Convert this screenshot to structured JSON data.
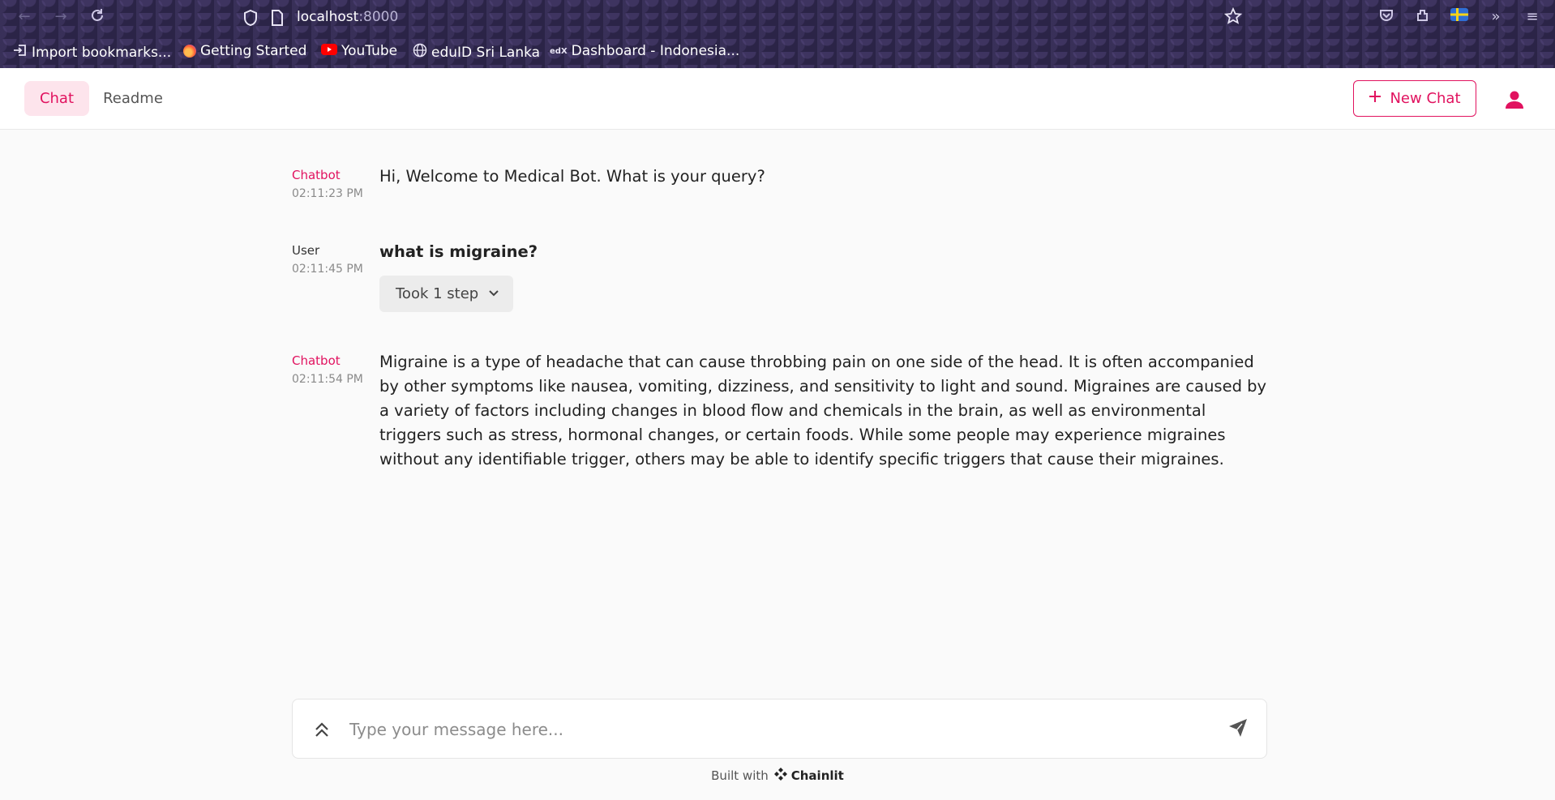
{
  "browser": {
    "url_host": "localhost",
    "url_port": ":8000",
    "bookmarks": [
      {
        "label": "Import bookmarks...",
        "icon": "import-icon"
      },
      {
        "label": "Getting Started",
        "icon": "firefox-icon"
      },
      {
        "label": "YouTube",
        "icon": "youtube-icon"
      },
      {
        "label": "eduID Sri Lanka",
        "icon": "globe-icon"
      },
      {
        "label": "Dashboard - Indonesia...",
        "icon": "edx-icon"
      }
    ]
  },
  "header": {
    "tabs": [
      {
        "label": "Chat"
      },
      {
        "label": "Readme"
      }
    ],
    "new_chat_label": "New Chat",
    "accent_color": "#e1125f"
  },
  "messages": [
    {
      "author": "Chatbot",
      "time": "02:11:23 PM",
      "text": "Hi, Welcome to Medical Bot. What is your query?"
    },
    {
      "author": "User",
      "time": "02:11:45 PM",
      "text": "what is migraine?",
      "step_label": "Took 1 step"
    },
    {
      "author": "Chatbot",
      "time": "02:11:54 PM",
      "text": "Migraine is a type of headache that can cause throbbing pain on one side of the head. It is often accompanied by other symptoms like nausea, vomiting, dizziness, and sensitivity to light and sound. Migraines are caused by a variety of factors including changes in blood flow and chemicals in the brain, as well as environmental triggers such as stress, hormonal changes, or certain foods. While some people may experience migraines without any identifiable trigger, others may be able to identify specific triggers that cause their migraines."
    }
  ],
  "composer": {
    "placeholder": "Type your message here..."
  },
  "footer": {
    "built_with": "Built with",
    "brand": "Chainlit"
  }
}
